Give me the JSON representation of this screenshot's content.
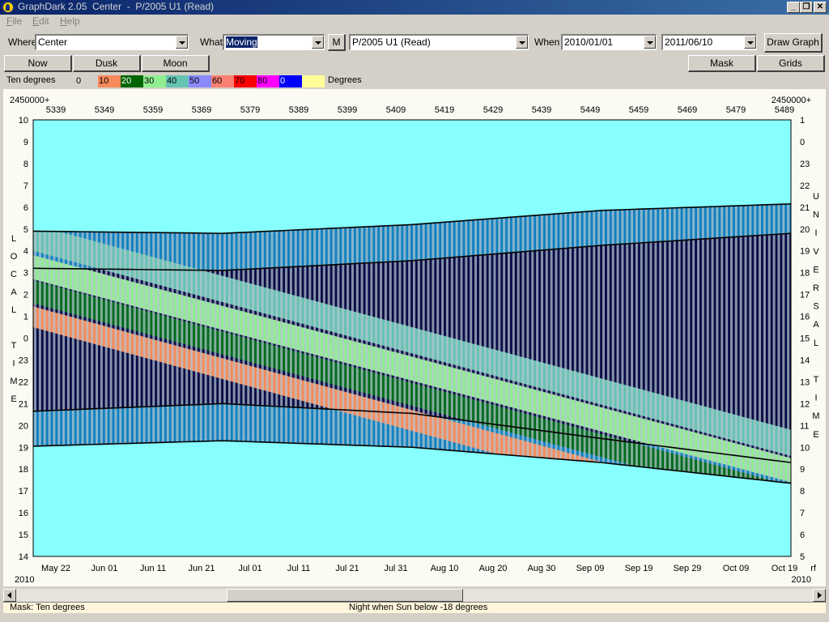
{
  "window": {
    "title": "GraphDark 2.05  Center  -  P/2005 U1 (Read)",
    "controls": [
      "_",
      "❐",
      "✕"
    ]
  },
  "menu": {
    "items": [
      {
        "label": "File",
        "mnemonic": "F",
        "rest": "ile"
      },
      {
        "label": "Edit",
        "mnemonic": "E",
        "rest": "dit"
      },
      {
        "label": "Help",
        "mnemonic": "H",
        "rest": "elp"
      }
    ]
  },
  "toolbar": {
    "where_label": "Where",
    "where_value": "Center",
    "what_label": "What",
    "what_value": "Moving",
    "m_button": "M",
    "object_value": "P/2005 U1 (Read)",
    "when_label": "When",
    "date_from": "2010/01/01",
    "date_to": "2011/06/10",
    "draw_button": "Draw Graph"
  },
  "buttons": {
    "now": "Now",
    "dusk": "Dusk",
    "moon": "Moon",
    "mask": "Mask",
    "grids": "Grids"
  },
  "legend": {
    "label": "Ten degrees",
    "unit": "Degrees",
    "entries": [
      {
        "text": "0",
        "color": "#f2f2f2"
      },
      {
        "text": "10",
        "color": "#f78a5b"
      },
      {
        "text": "20",
        "color": "#006400"
      },
      {
        "text": "30",
        "color": "#90ee90"
      },
      {
        "text": "40",
        "color": "#66c2b2"
      },
      {
        "text": "50",
        "color": "#8a8aff"
      },
      {
        "text": "60",
        "color": "#fa8072"
      },
      {
        "text": "70",
        "color": "#ff0000"
      },
      {
        "text": "80",
        "color": "#ff00ff"
      },
      {
        "text": "0",
        "color": "#0000ff"
      },
      {
        "text": "",
        "color": "#ffff99"
      }
    ]
  },
  "chart_data": {
    "type": "heatmap",
    "jd_prefix": "2450000+",
    "jd_ticks": [
      "5339",
      "5349",
      "5359",
      "5369",
      "5379",
      "5389",
      "5399",
      "5409",
      "5419",
      "5429",
      "5439",
      "5449",
      "5459",
      "5469",
      "5479",
      "5489"
    ],
    "date_ticks": [
      "May 22",
      "Jun 01",
      "Jun 11",
      "Jun 21",
      "Jul 01",
      "Jul 11",
      "Jul 21",
      "Jul 31",
      "Aug 10",
      "Aug 20",
      "Aug 30",
      "Sep 09",
      "Sep 19",
      "Sep 29",
      "Oct 09",
      "Oct 19"
    ],
    "x_end_mark": "rf",
    "year_left": "2010",
    "year_right": "2010",
    "left_axis_title": [
      "L",
      "O",
      "C",
      "A",
      "L",
      "",
      "T",
      "I",
      "M",
      "E"
    ],
    "right_axis_title": [
      "U",
      "N",
      "I",
      "V",
      "E",
      "R",
      "S",
      "A",
      "L",
      "",
      "T",
      "I",
      "M",
      "E"
    ],
    "local_time_ticks": [
      "10",
      "9",
      "8",
      "7",
      "6",
      "5",
      "4",
      "3",
      "2",
      "1",
      "0",
      "23",
      "22",
      "21",
      "20",
      "19",
      "18",
      "17",
      "16",
      "15",
      "14"
    ],
    "universal_time_ticks": [
      "1",
      "0",
      "23",
      "22",
      "21",
      "20",
      "19",
      "18",
      "17",
      "16",
      "15",
      "14",
      "13",
      "12",
      "11",
      "10",
      "9",
      "8",
      "7",
      "6",
      "5"
    ],
    "day_range": [
      0,
      160
    ],
    "local_time_range": [
      14,
      34
    ],
    "colors": {
      "daylight": "#88ffff",
      "night_low": "#c0c0d0",
      "deep_night": "#0a0a46",
      "twilight_band": "#1080c0",
      "band_10": "#f78a5b",
      "band_20": "#006a1c",
      "band_30": "#90ee90",
      "band_40": "#66c2b2",
      "object_stripe": "#b4c8d0"
    },
    "curves": {
      "sunset_local": [
        [
          0,
          19.05
        ],
        [
          40,
          19.3
        ],
        [
          80,
          19.0
        ],
        [
          120,
          18.3
        ],
        [
          160,
          17.35
        ]
      ],
      "dusk_local": [
        [
          0,
          20.65
        ],
        [
          40,
          21.0
        ],
        [
          80,
          20.55
        ],
        [
          120,
          19.4
        ],
        [
          160,
          18.3
        ]
      ],
      "dawn_local": [
        [
          0,
          27.2
        ],
        [
          40,
          27.1
        ],
        [
          80,
          27.55
        ],
        [
          120,
          28.25
        ],
        [
          160,
          28.8
        ]
      ],
      "sunrise_local": [
        [
          0,
          28.9
        ],
        [
          40,
          28.8
        ],
        [
          80,
          29.2
        ],
        [
          120,
          29.85
        ],
        [
          160,
          30.15
        ]
      ]
    },
    "elevation_bands": [
      {
        "color": "#f78a5b",
        "start": [
          0,
          24.5
        ],
        "end": [
          160,
          15.0
        ],
        "width": 0.95
      },
      {
        "color": "#006a1c",
        "start": [
          0,
          25.6
        ],
        "end": [
          160,
          16.2
        ],
        "width": 1.05
      },
      {
        "color": "#90ee90",
        "start": [
          0,
          26.7
        ],
        "end": [
          160,
          17.4
        ],
        "width": 1.1
      },
      {
        "color": "#66c2b2",
        "start": [
          0,
          28.0
        ],
        "end": [
          160,
          18.6
        ],
        "width": 1.2
      }
    ]
  },
  "status": {
    "mask": "Mask:  Ten degrees",
    "message": "Night when Sun below -18 degrees"
  }
}
